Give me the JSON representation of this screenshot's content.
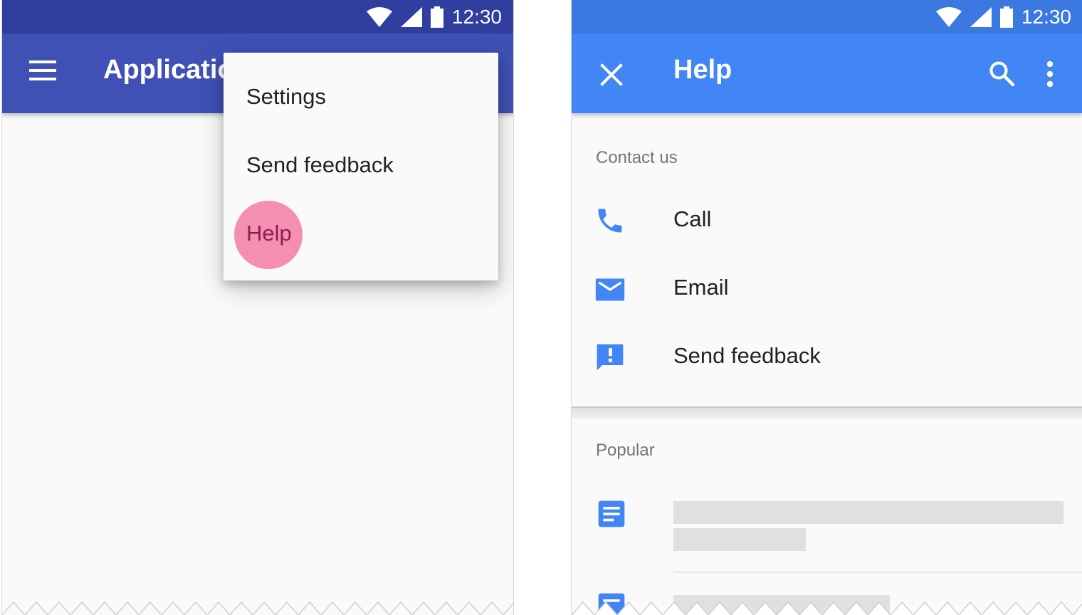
{
  "left_phone": {
    "status_time": "12:30",
    "app_title": "Application",
    "menu": {
      "items": [
        {
          "label": "Settings"
        },
        {
          "label": "Send feedback"
        },
        {
          "label": "Help"
        }
      ]
    }
  },
  "right_phone": {
    "status_time": "12:30",
    "title": "Help",
    "contact": {
      "section_label": "Contact us",
      "items": [
        {
          "label": "Call",
          "icon": "phone-icon"
        },
        {
          "label": "Email",
          "icon": "email-icon"
        },
        {
          "label": "Send feedback",
          "icon": "feedback-icon"
        }
      ]
    },
    "popular": {
      "section_label": "Popular"
    }
  },
  "colors": {
    "indigo_status": "#303f9f",
    "indigo_appbar": "#3f51b5",
    "blue_status": "#3b78e0",
    "blue_appbar": "#4285f4",
    "ripple_pink": "#f48fb1",
    "icon_blue": "#4285f4"
  }
}
